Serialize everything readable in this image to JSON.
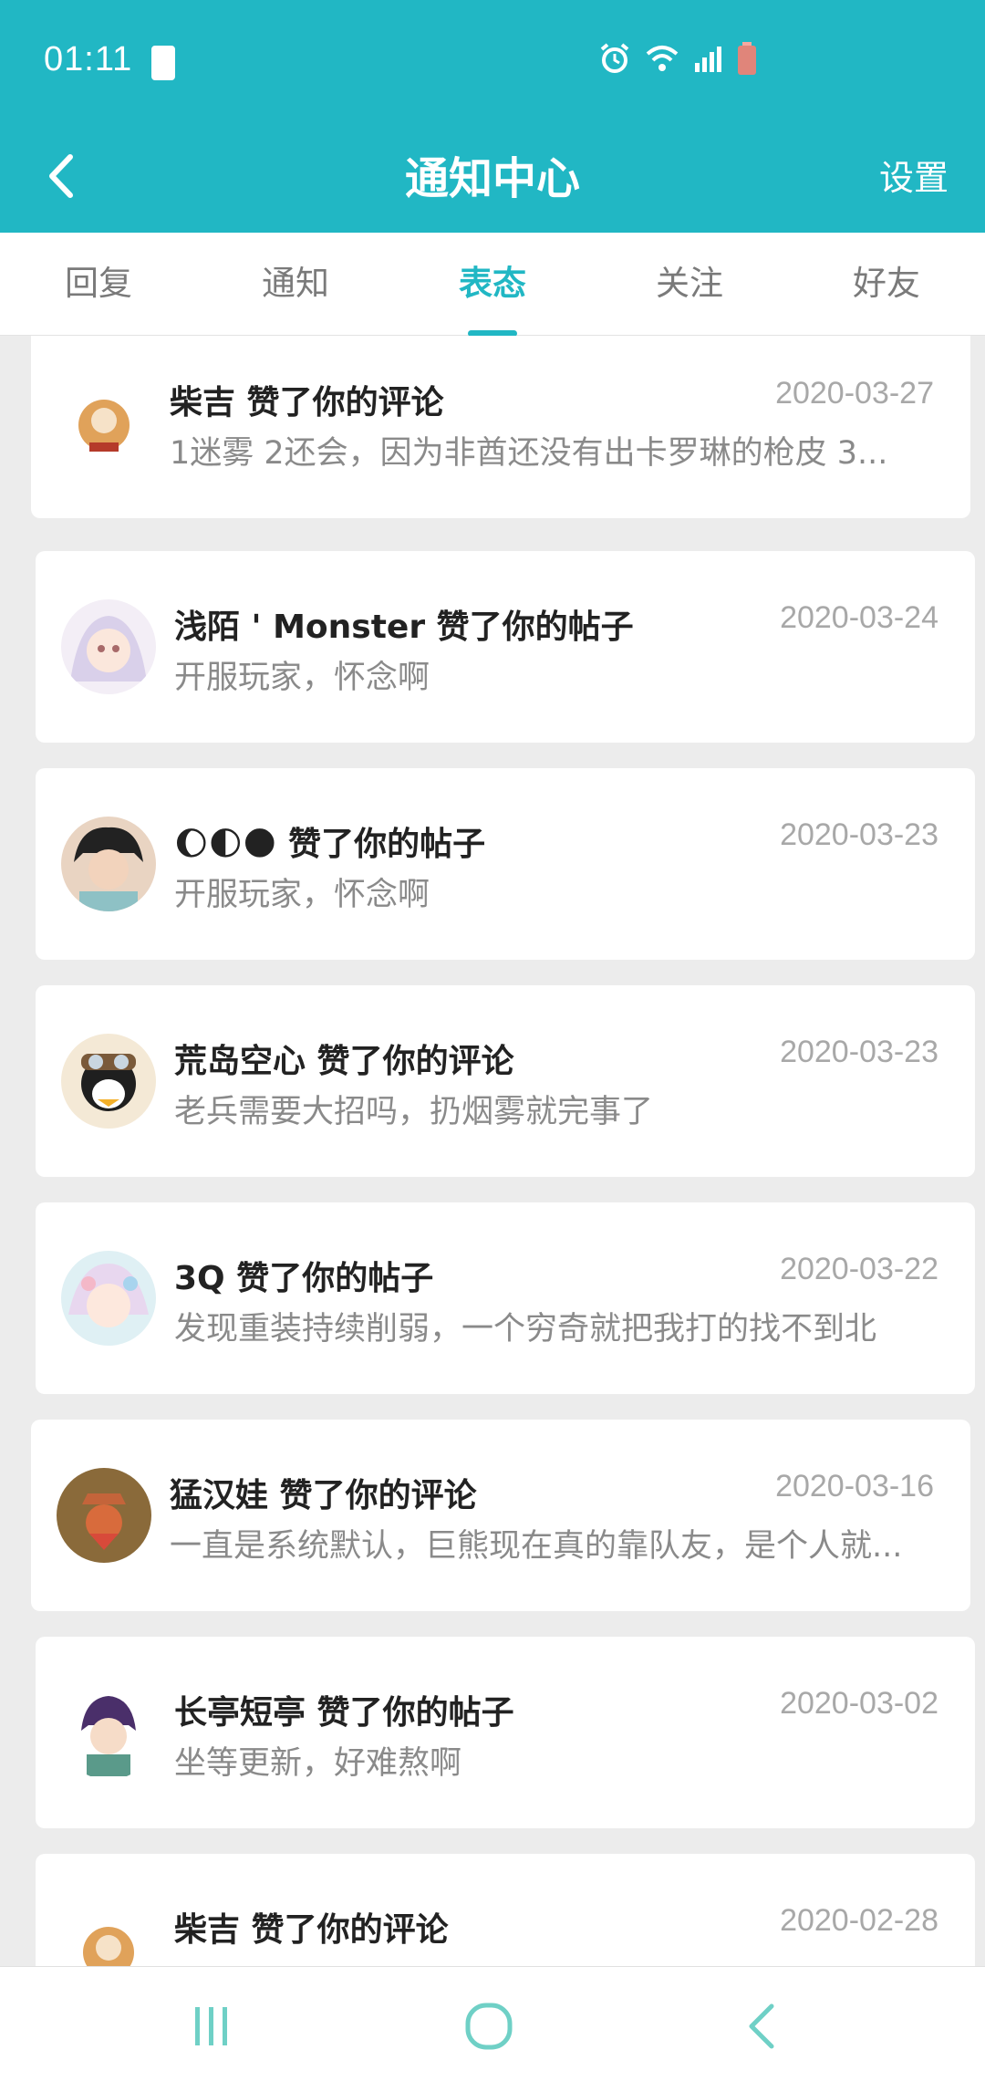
{
  "status_bar": {
    "time": "01:11",
    "icons": [
      "battery-saver-icon",
      "alarm-icon",
      "wifi-icon",
      "signal-icon",
      "battery-icon"
    ]
  },
  "header": {
    "title": "通知中心",
    "settings_label": "设置",
    "back_icon": "back-chevron-icon"
  },
  "tabs": [
    {
      "label": "回复",
      "active": false
    },
    {
      "label": "通知",
      "active": false
    },
    {
      "label": "表态",
      "active": true
    },
    {
      "label": "关注",
      "active": false
    },
    {
      "label": "好友",
      "active": false
    }
  ],
  "notifications": [
    {
      "user": "柴吉",
      "action": "赞了你的评论",
      "date": "2020-03-27",
      "snippet": "1迷雾 2还会，因为非酋还没有出卡罗琳的枪皮 3..."
    },
    {
      "user": "浅陌 ' Monster",
      "action": "赞了你的帖子",
      "date": "2020-03-24",
      "snippet": "开服玩家，怀念啊"
    },
    {
      "user": "🌔🌓🌑",
      "action": "赞了你的帖子",
      "date": "2020-03-23",
      "snippet": "开服玩家，怀念啊"
    },
    {
      "user": "荒岛空心",
      "action": "赞了你的评论",
      "date": "2020-03-23",
      "snippet": "老兵需要大招吗，扔烟雾就完事了"
    },
    {
      "user": "3Q",
      "action": "赞了你的帖子",
      "date": "2020-03-22",
      "snippet": "发现重装持续削弱，一个穷奇就把我打的找不到北"
    },
    {
      "user": "猛汉娃",
      "action": "赞了你的评论",
      "date": "2020-03-16",
      "snippet": "一直是系统默认，巨熊现在真的靠队友，是个人就..."
    },
    {
      "user": "长亭短亭",
      "action": "赞了你的帖子",
      "date": "2020-03-02",
      "snippet": "坐等更新，好难熬啊"
    },
    {
      "user": "柴吉",
      "action": "赞了你的评论",
      "date": "2020-02-28",
      "snippet": ""
    }
  ],
  "nav_bar": {
    "buttons": [
      "recent-apps-icon",
      "home-icon",
      "back-icon"
    ]
  },
  "colors": {
    "accent": "#21b7c4",
    "background": "#ececec",
    "date_gray": "#a8a8a8",
    "snippet_gray": "#8a8a8a"
  }
}
